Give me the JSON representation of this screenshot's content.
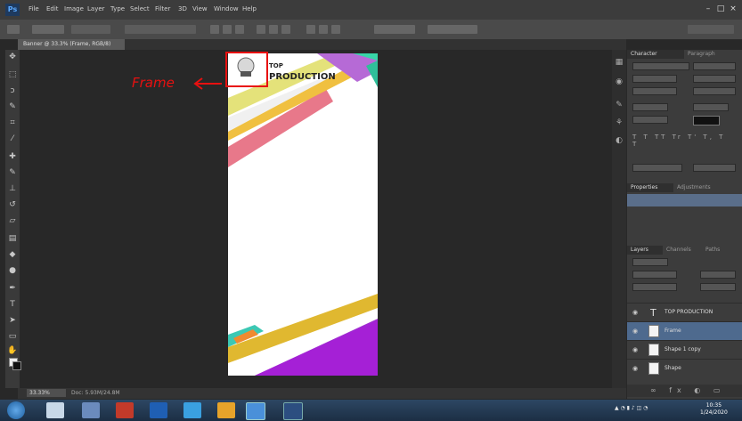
{
  "menubar": {
    "app_logo": "Ps",
    "menu_items": [
      "File",
      "Edit",
      "Image",
      "Layer",
      "Type",
      "Select",
      "Filter",
      "3D",
      "View",
      "Window",
      "Help"
    ]
  },
  "document": {
    "tab_title": "Banner @ 33.3% (Frame, RGB/8)",
    "poster_heading": "PRODUCTION",
    "poster_heading_prefix": "TOP"
  },
  "annotation": {
    "label": "Frame",
    "color": "#e81010"
  },
  "status": {
    "zoom": "33.33%",
    "doc_info": "Doc: 5.93M/24.8M"
  },
  "panels": {
    "character_tab": "Character",
    "paragraph_tab": "Paragraph",
    "properties_tab": "Properties",
    "adjustments_tab": "Adjustments",
    "layers_tab": "Layers",
    "channels_tab": "Channels",
    "paths_tab": "Paths",
    "layers": [
      {
        "name": "TOP PRODUCTION",
        "type": "text"
      },
      {
        "name": "Frame",
        "type": "image"
      },
      {
        "name": "Shape 1 copy",
        "type": "image"
      },
      {
        "name": "Shape",
        "type": "image"
      }
    ]
  },
  "taskbar": {
    "clock_time": "10:35",
    "clock_date": "1/24/2020"
  }
}
